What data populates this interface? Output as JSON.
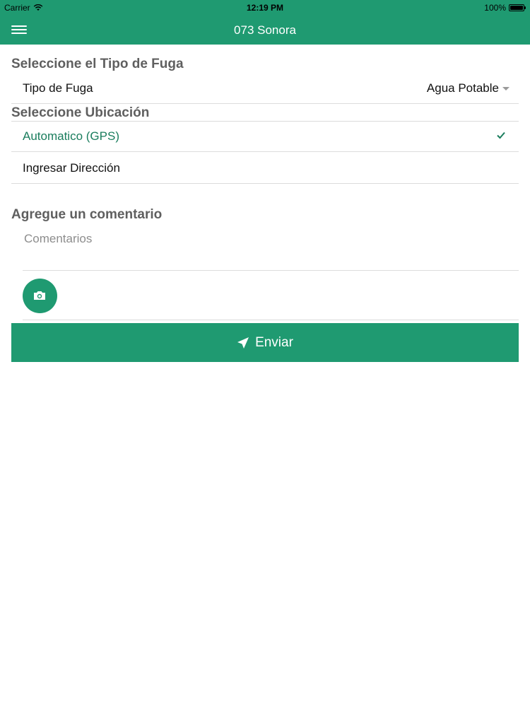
{
  "status_bar": {
    "carrier": "Carrier",
    "time": "12:19 PM",
    "battery": "100%",
    "battery_level": 1.0
  },
  "header": {
    "title": "073 Sonora",
    "menu_icon": "hamburger-menu-icon",
    "color": "#1f9a71"
  },
  "sections": {
    "leak_type_title": "Seleccione el Tipo de Fuga",
    "location_title": "Seleccione Ubicación",
    "comment_title": "Agregue un comentario"
  },
  "leak_type": {
    "label": "Tipo de Fuga",
    "value": "Agua Potable"
  },
  "location_options": [
    {
      "label": "Automatico (GPS)",
      "selected": true
    },
    {
      "label": "Ingresar Dirección",
      "selected": false
    }
  ],
  "comment": {
    "placeholder": "Comentarios",
    "value": ""
  },
  "camera": {
    "icon": "camera-icon"
  },
  "send_button": {
    "label": "Enviar",
    "icon": "paper-plane-icon"
  },
  "colors": {
    "accent": "#1f9a71",
    "selected_text": "#1a7d5d",
    "section_title": "#5f5f5f"
  }
}
